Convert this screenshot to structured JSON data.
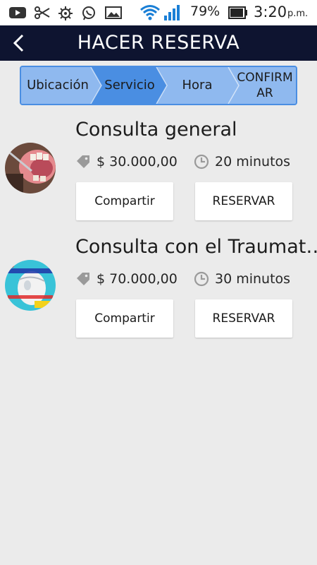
{
  "status_bar": {
    "battery_percent": "79%",
    "time": "3:20",
    "ampm": "p.m.",
    "icons": [
      "youtube-icon",
      "scissors-icon",
      "bug-icon",
      "whatsapp-icon",
      "gallery-icon",
      "wifi-icon",
      "signal-icon",
      "battery-icon"
    ]
  },
  "header": {
    "title": "HACER RESERVA",
    "back_icon": "back-arrow-icon"
  },
  "stepper": {
    "steps": [
      {
        "label": "Ubicación",
        "state": "done"
      },
      {
        "label": "Servicio",
        "state": "active"
      },
      {
        "label": "Hora",
        "state": "pending"
      },
      {
        "label": "CONFIRMAR",
        "line1": "CONFIRM",
        "line2": "AR",
        "state": "pending"
      }
    ],
    "colors": {
      "done": "#8fb9ef",
      "active": "#4a8ee2",
      "pending": "#8fb9ef",
      "border": "#4a8ee2"
    }
  },
  "services": [
    {
      "title": "Consulta general",
      "price": "$ 30.000,00",
      "duration": "20 minutos",
      "share_label": "Compartir",
      "book_label": "RESERVAR"
    },
    {
      "title": "Consulta con el Traumat…",
      "price": "$ 70.000,00",
      "duration": "30 minutos",
      "share_label": "Compartir",
      "book_label": "RESERVAR"
    }
  ],
  "colors": {
    "app_bar": "#0e1430",
    "background": "#ebebeb",
    "button_bg": "#ffffff"
  }
}
